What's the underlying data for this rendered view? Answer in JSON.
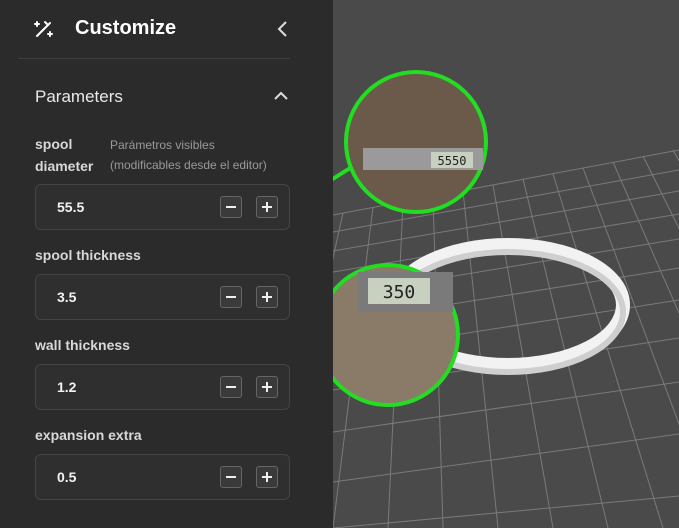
{
  "panel": {
    "title": "Customize",
    "section_title": "Parameters",
    "hint": [
      "Parámetros visibles",
      "(modificables desde el editor)"
    ],
    "fields": [
      {
        "label_lines": [
          "spool",
          "diameter"
        ],
        "value": "55.5"
      },
      {
        "label": "spool thickness",
        "value": "3.5"
      },
      {
        "label": "wall thickness",
        "value": "1.2"
      },
      {
        "label": "expansion extra",
        "value": "0.5"
      }
    ]
  },
  "viewport": {
    "callouts": [
      {
        "reading": "5550"
      },
      {
        "reading": "350"
      }
    ],
    "accent_color": "#22dd22",
    "background_color": "#4a4a4a"
  }
}
